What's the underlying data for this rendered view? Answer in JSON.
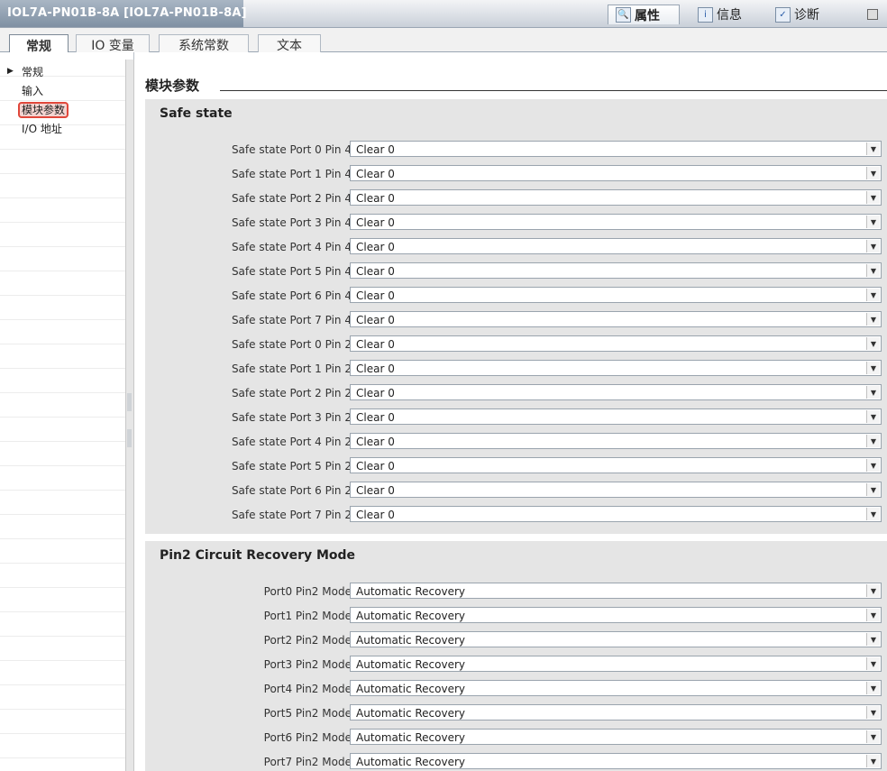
{
  "window": {
    "title": "IOL7A-PN01B-8A [IOL7A-PN01B-8A]"
  },
  "right_tabs": [
    {
      "label": "属性",
      "icon": "magnifier-icon"
    },
    {
      "label": "信息",
      "icon": "info-icon"
    },
    {
      "label": "诊断",
      "icon": "diagnostics-icon"
    }
  ],
  "tabs": [
    {
      "label": "常规"
    },
    {
      "label": "IO 变量"
    },
    {
      "label": "系统常数"
    },
    {
      "label": "文本"
    }
  ],
  "sidebar": {
    "items": [
      {
        "label": "常规"
      },
      {
        "label": "输入"
      },
      {
        "label": "模块参数"
      },
      {
        "label": "I/O 地址"
      }
    ]
  },
  "section": {
    "title": "模块参数"
  },
  "safe_state": {
    "title": "Safe state",
    "rows": [
      {
        "label": "Safe state Port 0 Pin 4:",
        "value": "Clear 0"
      },
      {
        "label": "Safe state Port 1 Pin 4:",
        "value": "Clear 0"
      },
      {
        "label": "Safe state Port 2 Pin 4:",
        "value": "Clear 0"
      },
      {
        "label": "Safe state Port 3 Pin 4:",
        "value": "Clear 0"
      },
      {
        "label": "Safe state Port 4 Pin 4:",
        "value": "Clear 0"
      },
      {
        "label": "Safe state Port 5 Pin 4:",
        "value": "Clear 0"
      },
      {
        "label": "Safe state Port 6 Pin 4:",
        "value": "Clear 0"
      },
      {
        "label": "Safe state Port 7 Pin 4:",
        "value": "Clear 0"
      },
      {
        "label": "Safe state Port 0 Pin 2:",
        "value": "Clear 0"
      },
      {
        "label": "Safe state Port 1 Pin 2:",
        "value": "Clear 0"
      },
      {
        "label": "Safe state Port 2 Pin 2:",
        "value": "Clear 0"
      },
      {
        "label": "Safe state Port 3 Pin 2:",
        "value": "Clear 0"
      },
      {
        "label": "Safe state Port 4 Pin 2:",
        "value": "Clear 0"
      },
      {
        "label": "Safe state Port 5 Pin 2:",
        "value": "Clear 0"
      },
      {
        "label": "Safe state Port 6 Pin 2:",
        "value": "Clear 0"
      },
      {
        "label": "Safe state Port 7 Pin 2:",
        "value": "Clear 0"
      }
    ]
  },
  "recovery": {
    "title": "Pin2 Circuit Recovery Mode",
    "rows": [
      {
        "label": "Port0 Pin2 Mode:",
        "value": "Automatic Recovery"
      },
      {
        "label": "Port1 Pin2 Mode:",
        "value": "Automatic Recovery"
      },
      {
        "label": "Port2 Pin2 Mode:",
        "value": "Automatic Recovery"
      },
      {
        "label": "Port3 Pin2 Mode:",
        "value": "Automatic Recovery"
      },
      {
        "label": "Port4 Pin2 Mode:",
        "value": "Automatic Recovery"
      },
      {
        "label": "Port5 Pin2 Mode:",
        "value": "Automatic Recovery"
      },
      {
        "label": "Port6 Pin2 Mode:",
        "value": "Automatic Recovery"
      },
      {
        "label": "Port7 Pin2 Mode:",
        "value": "Automatic Recovery"
      }
    ]
  }
}
